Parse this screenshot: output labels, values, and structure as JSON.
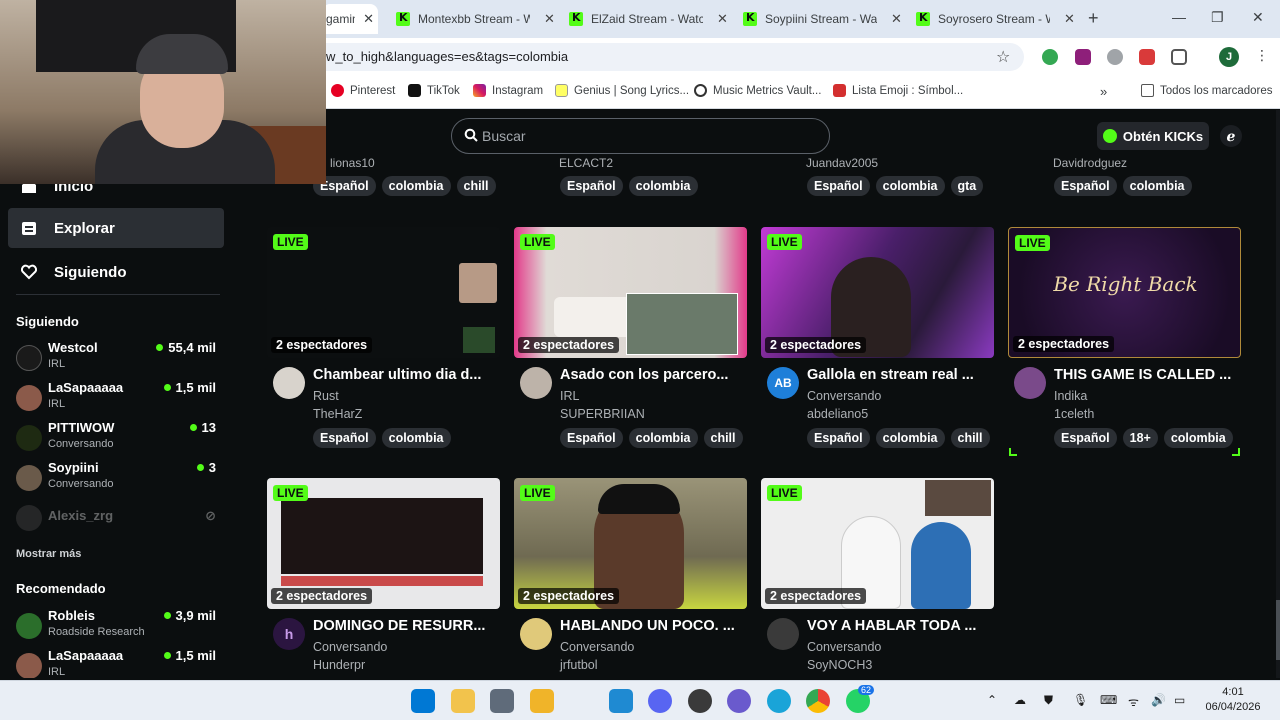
{
  "browser": {
    "tabs": [
      {
        "title": "gaming",
        "partial": true
      },
      {
        "title": "Montexbb Stream - Wa"
      },
      {
        "title": "ElZaid Stream - Watch"
      },
      {
        "title": "Soypiini Stream - Watc"
      },
      {
        "title": "Soyrosero Stream - Wa"
      }
    ],
    "url": "w_to_high&languages=es&tags=colombia",
    "profile_letter": "J",
    "bookmarks": [
      "Pinterest",
      "TikTok",
      "Instagram",
      "Genius | Song Lyrics...",
      "Music Metrics Vault...",
      "Lista Emoji : Símbol..."
    ],
    "all_bookmarks": "Todos los marcadores"
  },
  "header": {
    "search_placeholder": "Buscar",
    "kicks_button": "Obtén KICKs"
  },
  "sidebar": {
    "nav": [
      {
        "label": "Inicio",
        "icon": "home-icon"
      },
      {
        "label": "Explorar",
        "icon": "compass-icon",
        "selected": true
      },
      {
        "label": "Siguiendo",
        "icon": "heart-icon"
      }
    ],
    "following_title": "Siguiendo",
    "following": [
      {
        "name": "Westcol",
        "category": "IRL",
        "viewers": "55,4 mil",
        "color": "#1a1a1a"
      },
      {
        "name": "LaSapaaaaa",
        "category": "IRL",
        "viewers": "1,5 mil",
        "color": "#8b5a4a"
      },
      {
        "name": "PITTIWOW",
        "category": "Conversando",
        "viewers": "13",
        "color": "#1e2a12"
      },
      {
        "name": "Soypiini",
        "category": "Conversando",
        "viewers": "3",
        "color": "#6a5a4a"
      },
      {
        "name": "Alexis_zrg",
        "category": "",
        "viewers": "",
        "offline": true,
        "color": "#555"
      }
    ],
    "show_more": "Mostrar más",
    "recommended_title": "Recomendado",
    "recommended": [
      {
        "name": "Robleis",
        "category": "Roadside Research",
        "viewers": "3,9 mil",
        "color": "#2b6e2b"
      },
      {
        "name": "LaSapaaaaa",
        "category": "IRL",
        "viewers": "1,5 mil",
        "color": "#8b5a4a"
      }
    ]
  },
  "top_partial_row": {
    "streamers": [
      "lionas10",
      "ELCACT2",
      "Juandav2005",
      "Davidrodguez"
    ],
    "tags": [
      [
        "Español",
        "colombia",
        "chill"
      ],
      [
        "Español",
        "colombia"
      ],
      [
        "Español",
        "colombia",
        "gta"
      ],
      [
        "Español",
        "colombia"
      ]
    ]
  },
  "streams": [
    {
      "live": "LIVE",
      "viewers": "2 espectadores",
      "title": "Chambear ultimo dia d...",
      "category": "Rust",
      "streamer": "TheHarZ",
      "tags": [
        "Español",
        "colombia"
      ],
      "thumb": "#0c0f10",
      "avatar": "#d8d3cc"
    },
    {
      "live": "LIVE",
      "viewers": "2 espectadores",
      "title": "Asado con los parcero...",
      "category": "IRL",
      "streamer": "SUPERBRIIAN",
      "tags": [
        "Español",
        "colombia",
        "chill"
      ],
      "thumb": "#d9d4cf",
      "avatar": "#bdb3a9"
    },
    {
      "live": "LIVE",
      "viewers": "2 espectadores",
      "title": "Gallola en stream real ...",
      "category": "Conversando",
      "streamer": "abdeliano5",
      "tags": [
        "Español",
        "colombia",
        "chill"
      ],
      "thumb": "#6a2fa8",
      "avatar": "#1e7fd9",
      "avatar_text": "AB"
    },
    {
      "live": "LIVE",
      "viewers": "2 espectadores",
      "title": "THIS GAME IS CALLED ...",
      "category": "Indika",
      "streamer": "1celeth",
      "tags": [
        "Español",
        "18+",
        "colombia"
      ],
      "thumb": "#2a1238",
      "avatar": "#7a4a8a",
      "overlay_text": "Be Right Back"
    },
    {
      "live": "LIVE",
      "viewers": "2 espectadores",
      "title": "DOMINGO DE RESURR...",
      "category": "Conversando",
      "streamer": "Hunderpr",
      "tags": [],
      "thumb": "#e8e8ea",
      "avatar": "#2b1540"
    },
    {
      "live": "LIVE",
      "viewers": "2 espectadores",
      "title": "HABLANDO UN POCO. ...",
      "category": "Conversando",
      "streamer": "jrfutbol",
      "tags": [],
      "thumb": "#8a8060",
      "avatar": "#e0c97a"
    },
    {
      "live": "LIVE",
      "viewers": "2 espectadores",
      "title": "VOY A HABLAR TODA ...",
      "category": "Conversando",
      "streamer": "SoyNOCH3",
      "tags": [],
      "thumb": "#eeeeee",
      "avatar": "#3a3a3a"
    }
  ],
  "taskbar": {
    "time": "4:01",
    "date": "06/04/2026",
    "whatsapp_badge": "62"
  },
  "colors": {
    "kick_green": "#53fc18",
    "background": "#0b0e0f",
    "chip": "#2b2f34"
  }
}
